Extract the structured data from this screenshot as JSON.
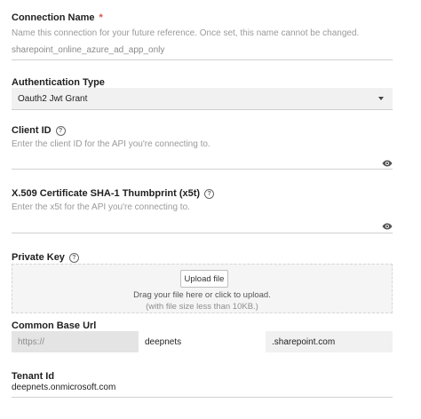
{
  "connection_name": {
    "label": "Connection Name",
    "required_mark": "*",
    "help": "Name this connection for your future reference. Once set, this name cannot be changed.",
    "value": "sharepoint_online_azure_ad_app_only"
  },
  "auth_type": {
    "label": "Authentication Type",
    "selected": "Oauth2 Jwt Grant"
  },
  "client_id": {
    "label": "Client ID",
    "help": "Enter the client ID for the API you're connecting to.",
    "value": ""
  },
  "x5t": {
    "label": "X.509 Certificate SHA-1 Thumbprint (x5t)",
    "help": "Enter the x5t for the API you're connecting to.",
    "value": ""
  },
  "private_key": {
    "label": "Private Key",
    "upload_label": "Upload file",
    "drop_text": "Drag your file here or click to upload.",
    "size_note": "(with file size less than 10KB.)"
  },
  "base_url": {
    "label": "Common Base Url",
    "scheme": "https://",
    "subdomain": "deepnets",
    "domain": ".sharepoint.com"
  },
  "tenant": {
    "label": "Tenant Id",
    "value": "deepnets.onmicrosoft.com"
  },
  "icons": {
    "help": "question-circle-icon",
    "reveal": "eye-icon",
    "dropdown": "caret-down-icon"
  }
}
